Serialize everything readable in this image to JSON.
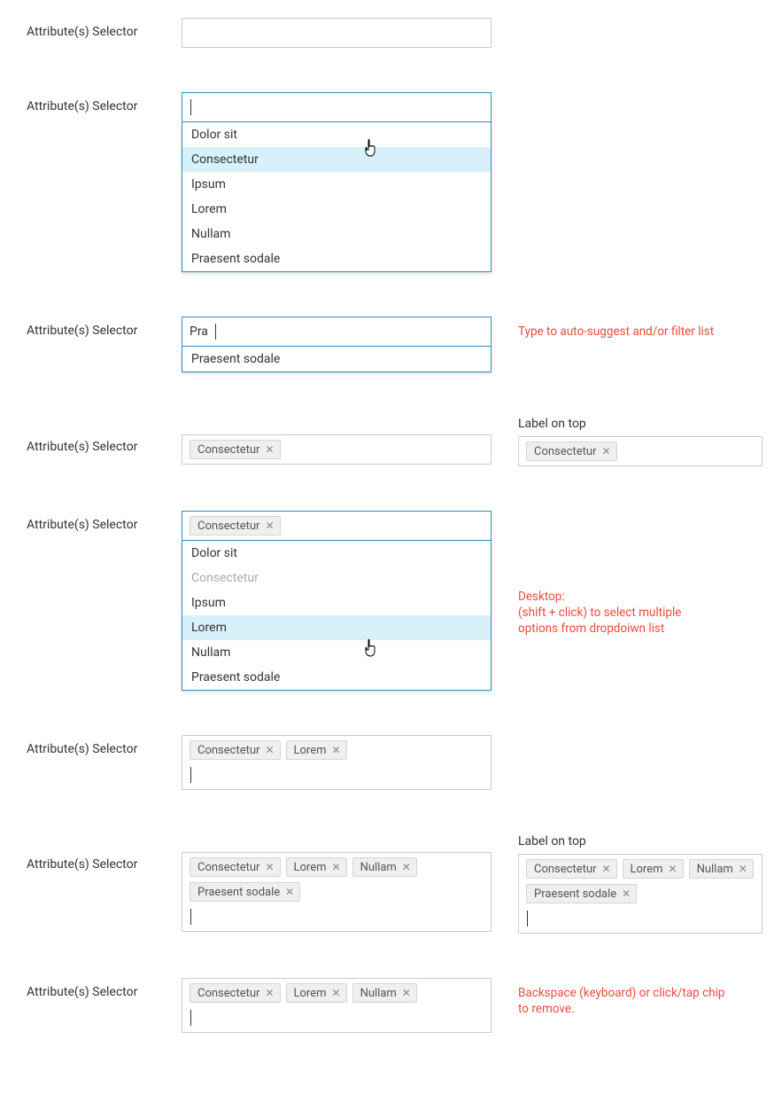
{
  "label": "Attribute(s) Selector",
  "label_on_top": "Label on top",
  "options": {
    "dolor": "Dolor sit",
    "consectetur": "Consectetur",
    "ipsum": "Ipsum",
    "lorem": "Lorem",
    "nullam": "Nullam",
    "praesent": "Praesent sodale"
  },
  "row3": {
    "typed": "Pra",
    "suggestion": "Praesent sodale",
    "note": "Type to auto-suggest and/or filter list"
  },
  "row4_chips": {
    "a": "Consectetur"
  },
  "row4b_chips": {
    "a": "Consectetur"
  },
  "row5": {
    "chip": "Consectetur",
    "note_title": "Desktop:",
    "note_body1": "(shift + click)  to select  multiple",
    "note_body2": "options from dropdoiwn list"
  },
  "row6_chips": {
    "a": "Consectetur",
    "b": "Lorem"
  },
  "row7_left_chips": {
    "a": "Consectetur",
    "b": "Lorem",
    "c": "Nullam",
    "d": "Praesent sodale"
  },
  "row7_right_chips": {
    "a": "Consectetur",
    "b": "Lorem",
    "c": "Nullam",
    "d": "Praesent sodale"
  },
  "row8_chips": {
    "a": "Consectetur",
    "b": "Lorem",
    "c": "Nullam"
  },
  "row8_note1": "Backspace (keyboard) or click/tap chip",
  "row8_note2": "to remove."
}
